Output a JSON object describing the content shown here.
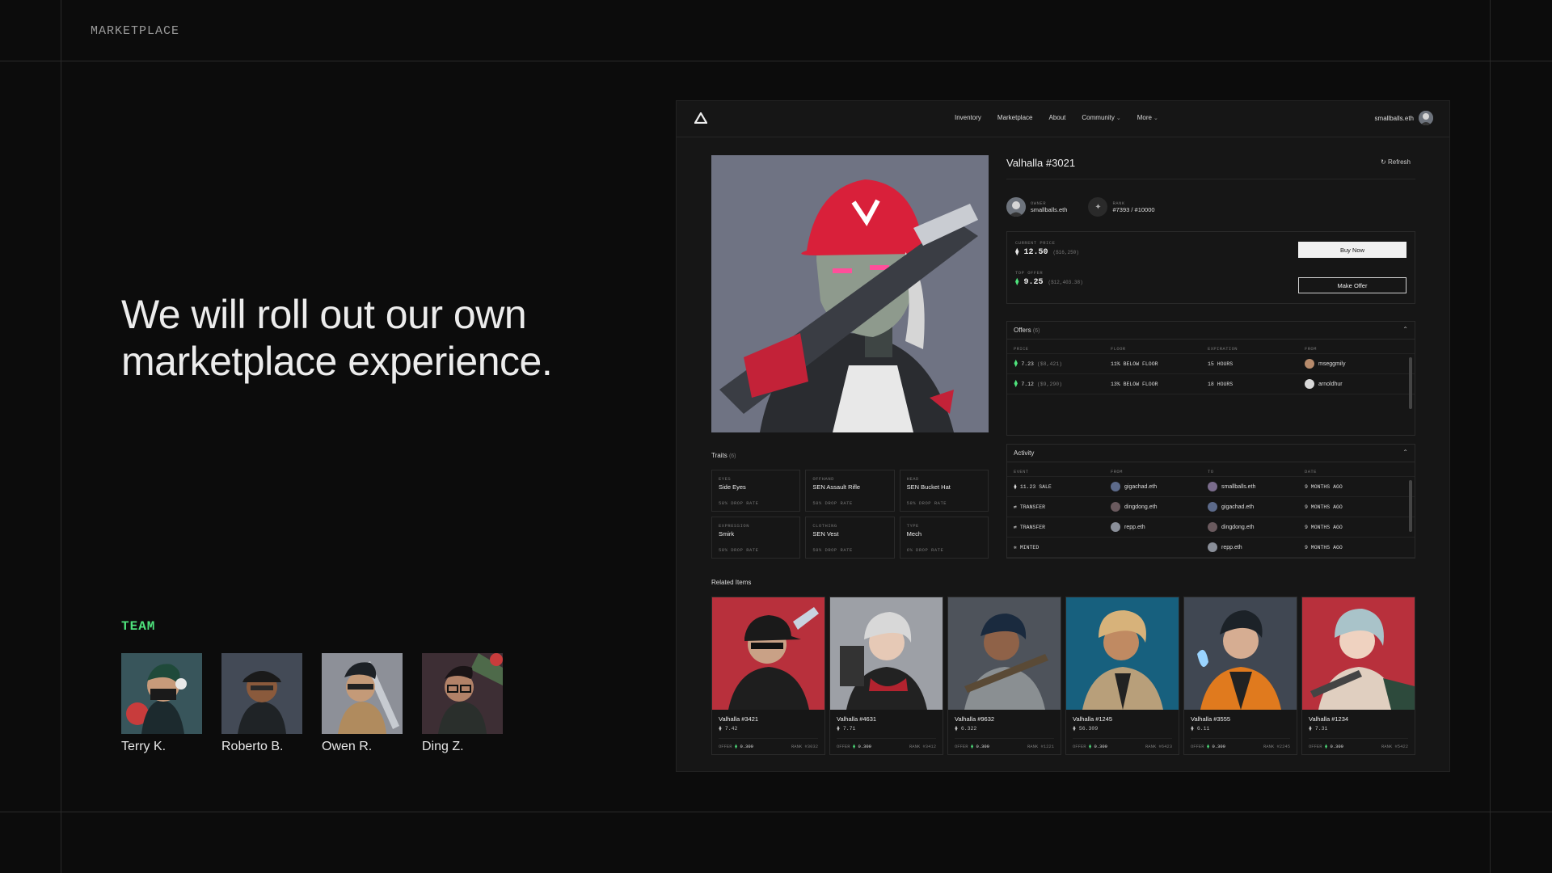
{
  "section_label": "MARKETPLACE",
  "headline": "We will roll out our own marketplace experience.",
  "team": {
    "label": "TEAM",
    "members": [
      {
        "name": "Terry K."
      },
      {
        "name": "Roberto B."
      },
      {
        "name": "Owen R."
      },
      {
        "name": "Ding Z."
      }
    ]
  },
  "app": {
    "nav": {
      "links": [
        "Inventory",
        "Marketplace",
        "About",
        "Community",
        "More"
      ],
      "user": "smallballs.eth"
    },
    "item": {
      "title": "Valhalla #3021",
      "refresh_label": "Refresh",
      "owner_label": "OWNER",
      "owner": "smallballs.eth",
      "rank_label": "RANK",
      "rank": "#7393 / #10000"
    },
    "price": {
      "current_label": "CURRENT PRICE",
      "current": "12.50",
      "current_usd": "($16,250)",
      "top_label": "TOP OFFER",
      "top": "9.25",
      "top_usd": "($12,403.38)",
      "buy_label": "Buy Now",
      "offer_label": "Make Offer"
    },
    "offers": {
      "title": "Offers",
      "count": "(6)",
      "columns": [
        "PRICE",
        "FLOOR",
        "EXPIRATION",
        "FROM"
      ],
      "rows": [
        {
          "price": "7.23",
          "usd": "($8,421)",
          "floor": "11% BELOW FLOOR",
          "exp": "15 HOURS",
          "from": "mseggmily"
        },
        {
          "price": "7.12",
          "usd": "($9,290)",
          "floor": "13% BELOW FLOOR",
          "exp": "18 HOURS",
          "from": "arnoldhur"
        }
      ]
    },
    "activity": {
      "title": "Activity",
      "columns": [
        "EVENT",
        "FROM",
        "TO",
        "DATE"
      ],
      "rows": [
        {
          "event": "11.23 SALE",
          "from": "gigachad.eth",
          "to": "smallballs.eth",
          "date": "9 MONTHS AGO"
        },
        {
          "event": "TRANSFER",
          "from": "dingdong.eth",
          "to": "gigachad.eth",
          "date": "9 MONTHS AGO"
        },
        {
          "event": "TRANSFER",
          "from": "repp.eth",
          "to": "dingdong.eth",
          "date": "9 MONTHS AGO"
        },
        {
          "event": "MINTED",
          "from": "",
          "to": "repp.eth",
          "date": "9 MONTHS AGO"
        }
      ]
    },
    "traits": {
      "title": "Traits",
      "count": "(6)",
      "items": [
        {
          "type": "EYES",
          "value": "Side Eyes",
          "rate": "58% DROP RATE"
        },
        {
          "type": "OFFHAND",
          "value": "SEN Assault Rifle",
          "rate": "58% DROP RATE"
        },
        {
          "type": "HEAD",
          "value": "SEN Bucket Hat",
          "rate": "58% DROP RATE"
        },
        {
          "type": "EXPRESSION",
          "value": "Smirk",
          "rate": "58% DROP RATE"
        },
        {
          "type": "CLOTHING",
          "value": "SEN Vest",
          "rate": "58% DROP RATE"
        },
        {
          "type": "TYPE",
          "value": "Mech",
          "rate": "6% DROP RATE"
        }
      ]
    },
    "related": {
      "title": "Related Items",
      "items": [
        {
          "name": "Valhalla #3421",
          "price": "7.42",
          "offer": "0.309",
          "rank": "RANK #3032",
          "bg": "#b8303c"
        },
        {
          "name": "Valhalla #4631",
          "price": "7.71",
          "offer": "0.309",
          "rank": "RANK #3412",
          "bg": "#9da0a6"
        },
        {
          "name": "Valhalla #9632",
          "price": "6.322",
          "offer": "0.309",
          "rank": "RANK #1221",
          "bg": "#4e535b"
        },
        {
          "name": "Valhalla #1245",
          "price": "56.309",
          "offer": "0.309",
          "rank": "RANK #6423",
          "bg": "#17607e"
        },
        {
          "name": "Valhalla #3555",
          "price": "6.11",
          "offer": "0.309",
          "rank": "RANK #2245",
          "bg": "#404752"
        },
        {
          "name": "Valhalla #1234",
          "price": "7.31",
          "offer": "0.309",
          "rank": "RANK #5422",
          "bg": "#b8303c"
        }
      ],
      "offer_label": "OFFER"
    }
  }
}
